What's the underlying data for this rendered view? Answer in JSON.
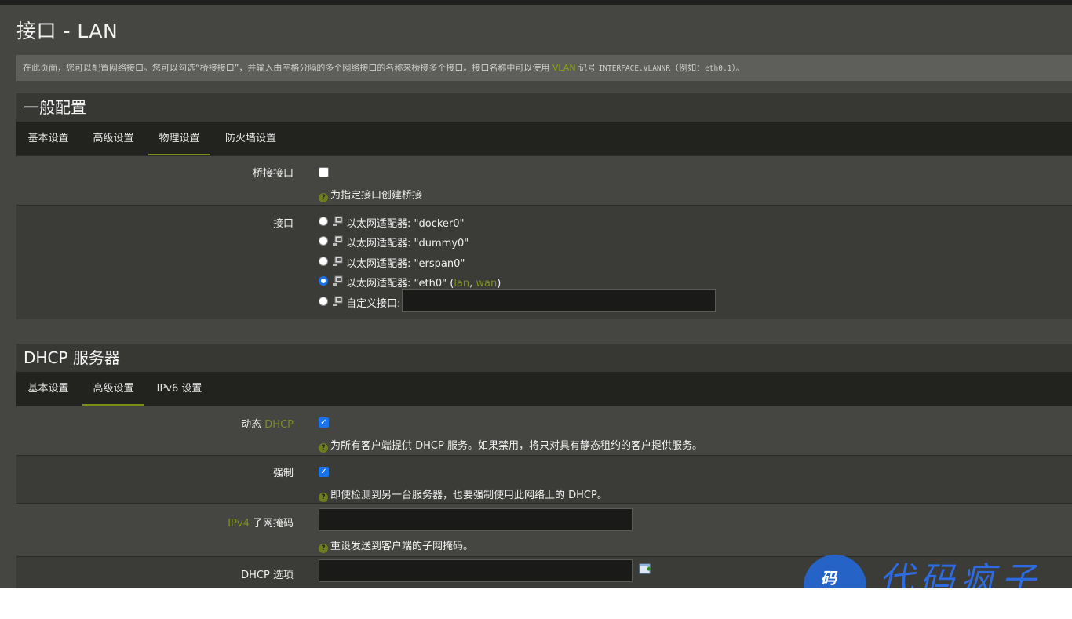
{
  "page": {
    "title": "接口 - LAN",
    "description": {
      "part1": "在此页面，您可以配置网络接口。您可以勾选“桥接接口”，并输入由空格分隔的多个网络接口的名称来桥接多个接口。接口名称中可以使用 ",
      "vlan": "VLAN",
      "part2": " 记号 ",
      "mono1": "INTERFACE.VLANNR",
      "part3": "（例如：",
      "mono2": "eth0.1",
      "part4": "）。"
    }
  },
  "general": {
    "heading": "一般配置",
    "tabs": [
      "基本设置",
      "高级设置",
      "物理设置",
      "防火墙设置"
    ],
    "active_tab": "物理设置",
    "bridge": {
      "label": "桥接接口",
      "checked": false,
      "help": "为指定接口创建桥接"
    },
    "interface": {
      "label": "接口",
      "options": [
        {
          "prefix": "以太网适配器: ",
          "name": "\"docker0\"",
          "selected": false
        },
        {
          "prefix": "以太网适配器: ",
          "name": "\"dummy0\"",
          "selected": false
        },
        {
          "prefix": "以太网适配器: ",
          "name": "\"erspan0\"",
          "selected": false
        },
        {
          "prefix": "以太网适配器: ",
          "name": "\"eth0\"",
          "selected": true,
          "zone_open": " (",
          "zone1": "lan",
          "zone_sep": ", ",
          "zone2": "wan",
          "zone_close": ")"
        }
      ],
      "custom_label": "自定义接口:",
      "custom_value": ""
    }
  },
  "dhcp": {
    "heading": "DHCP 服务器",
    "tabs": [
      "基本设置",
      "高级设置",
      "IPv6 设置"
    ],
    "active_tab": "高级设置",
    "dynamic": {
      "label_prefix": "动态 ",
      "label_hl": "DHCP",
      "checked": true,
      "help": "为所有客户端提供 DHCP 服务。如果禁用，将只对具有静态租约的客户提供服务。"
    },
    "force": {
      "label": "强制",
      "checked": true,
      "help": "即使检测到另一台服务器，也要强制使用此网络上的 DHCP。"
    },
    "netmask": {
      "label_hl": "IPv4",
      "label_rest": " 子网掩码",
      "value": "",
      "help": "重设发送到客户端的子网掩码。"
    },
    "options": {
      "label": "DHCP 选项",
      "value": ""
    }
  },
  "watermark": {
    "logo_text": "码",
    "text": "代码疯子"
  },
  "colors": {
    "accent": "#7a8f14",
    "checkbox": "#1a73e8",
    "watermark": "#2e6ae0"
  }
}
